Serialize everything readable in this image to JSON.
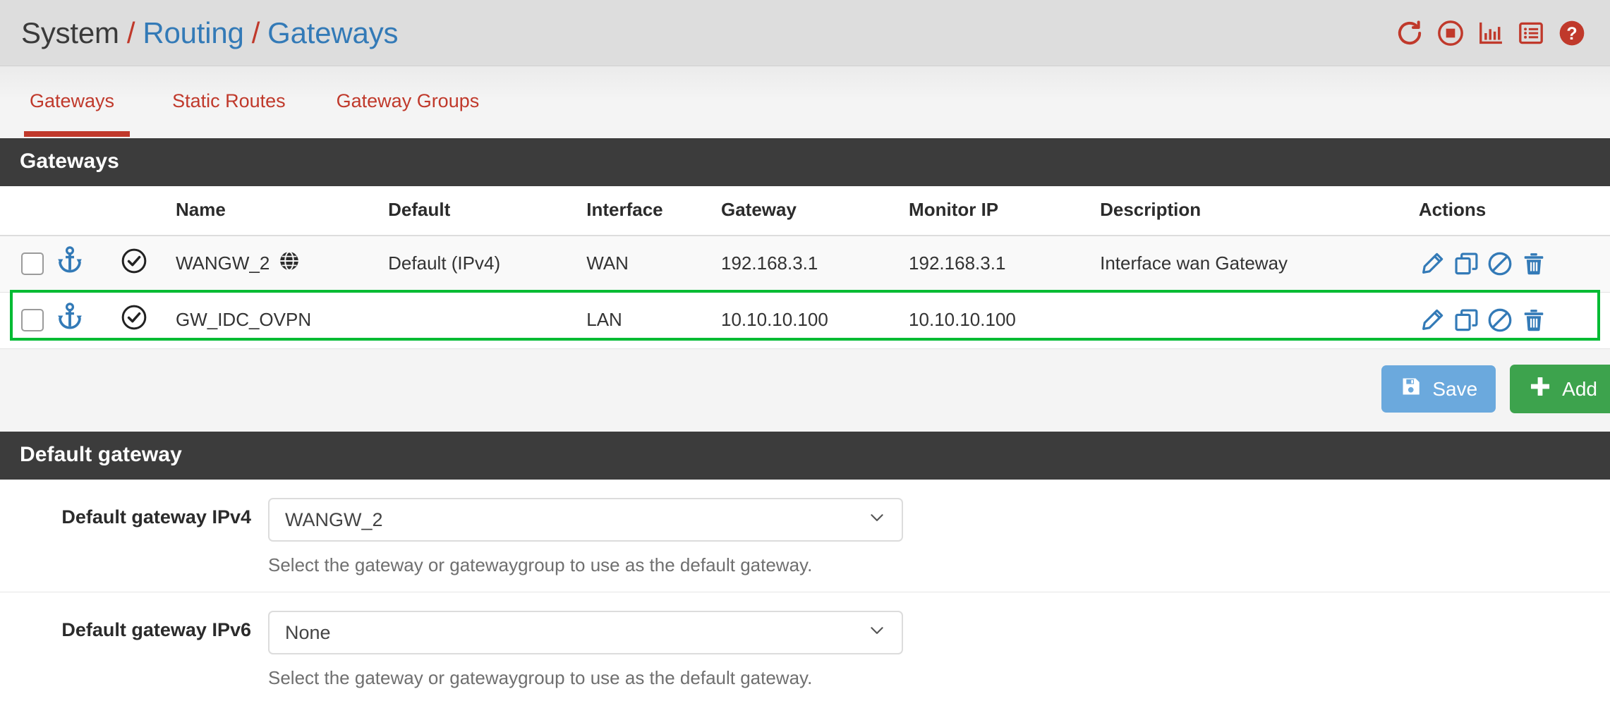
{
  "header": {
    "breadcrumb": {
      "root": "System",
      "sep": "/",
      "section": "Routing",
      "page": "Gateways"
    },
    "icons": [
      {
        "name": "restart-icon",
        "title": "Restart"
      },
      {
        "name": "stop-icon",
        "title": "Stop"
      },
      {
        "name": "chart-icon",
        "title": "Status Monitoring"
      },
      {
        "name": "log-icon",
        "title": "Logs"
      },
      {
        "name": "help-icon",
        "title": "Help"
      }
    ],
    "icon_color": "#c0392b"
  },
  "tabs": [
    {
      "label": "Gateways",
      "active": true
    },
    {
      "label": "Static Routes",
      "active": false
    },
    {
      "label": "Gateway Groups",
      "active": false
    }
  ],
  "gateways_panel": {
    "title": "Gateways",
    "columns": [
      "",
      "",
      "Name",
      "Default",
      "Interface",
      "Gateway",
      "Monitor IP",
      "Description",
      "Actions"
    ],
    "headers": {
      "name": "Name",
      "default": "Default",
      "interface": "Interface",
      "gateway": "Gateway",
      "monitor_ip": "Monitor IP",
      "description": "Description",
      "actions": "Actions"
    },
    "rows": [
      {
        "checked": false,
        "anchor": true,
        "status": "up",
        "name": "WANGW_2",
        "is_default_globe": true,
        "default": "Default (IPv4)",
        "interface": "WAN",
        "gateway": "192.168.3.1",
        "monitor_ip": "192.168.3.1",
        "description": "Interface wan Gateway",
        "highlighted": false
      },
      {
        "checked": false,
        "anchor": true,
        "status": "up",
        "name": "GW_IDC_OVPN",
        "is_default_globe": false,
        "default": "",
        "interface": "LAN",
        "gateway": "10.10.10.100",
        "monitor_ip": "10.10.10.100",
        "description": "",
        "highlighted": true
      }
    ],
    "row_actions": [
      "edit-icon",
      "copy-icon",
      "disable-icon",
      "delete-icon"
    ],
    "highlight_color": "#00bb33",
    "action_icon_color": "#337ab7",
    "anchor_color": "#337ab7"
  },
  "buttons": {
    "save": "Save",
    "add": "Add",
    "save_color": "#6ba9dd",
    "add_color": "#3da34d"
  },
  "default_gateway_panel": {
    "title": "Default gateway",
    "fields": [
      {
        "label": "Default gateway IPv4",
        "value": "WANGW_2",
        "help": "Select the gateway or gatewaygroup to use as the default gateway."
      },
      {
        "label": "Default gateway IPv6",
        "value": "None",
        "help": "Select the gateway or gatewaygroup to use as the default gateway."
      }
    ]
  }
}
